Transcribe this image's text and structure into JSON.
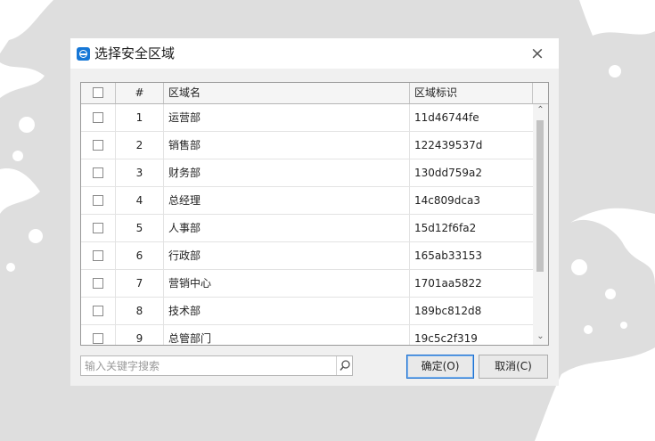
{
  "dialog": {
    "title": "选择安全区域",
    "close_symbol": "×",
    "app_icon": "app-logo-icon"
  },
  "table": {
    "columns": [
      "#",
      "区域名",
      "区域标识"
    ],
    "rows": [
      {
        "num": "1",
        "name": "运营部",
        "id": "11d46744fe"
      },
      {
        "num": "2",
        "name": "销售部",
        "id": "122439537d"
      },
      {
        "num": "3",
        "name": "财务部",
        "id": "130dd759a2"
      },
      {
        "num": "4",
        "name": "总经理",
        "id": "14c809dca3"
      },
      {
        "num": "5",
        "name": "人事部",
        "id": "15d12f6fa2"
      },
      {
        "num": "6",
        "name": "行政部",
        "id": "165ab33153"
      },
      {
        "num": "7",
        "name": "营销中心",
        "id": "1701aa5822"
      },
      {
        "num": "8",
        "name": "技术部",
        "id": "189bc812d8"
      },
      {
        "num": "9",
        "name": "总管部门",
        "id": "19c5c2f319"
      }
    ]
  },
  "search": {
    "placeholder": "输入关键字搜索",
    "value": ""
  },
  "buttons": {
    "ok_label": "确定(O)",
    "cancel_label": "取消(C)"
  },
  "colors": {
    "accent": "#1677d6",
    "background": "#dcdcdc"
  }
}
